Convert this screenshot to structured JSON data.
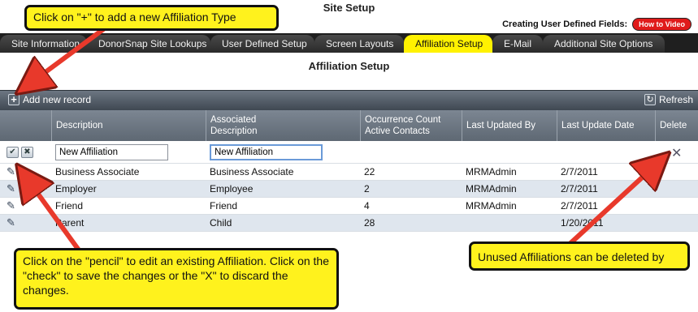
{
  "header": {
    "title": "Site Setup",
    "udf_label": "Creating User Defined Fields:",
    "video_button": "How to Video"
  },
  "tabs": [
    {
      "label": "Site Information"
    },
    {
      "label": "DonorSnap Site Lookups"
    },
    {
      "label": "User Defined Setup"
    },
    {
      "label": "Screen Layouts"
    },
    {
      "label": "Affiliation Setup",
      "active": true
    },
    {
      "label": "E-Mail"
    },
    {
      "label": "Additional Site Options"
    }
  ],
  "section_title": "Affiliation Setup",
  "toolbar": {
    "add_label": "Add new record",
    "refresh_label": "Refresh",
    "add_icon": "plus-icon",
    "refresh_icon": "refresh-icon"
  },
  "columns": {
    "description": "Description",
    "assoc_line1": "Associated",
    "assoc_line2": "Description",
    "count_line1": "Occurrence Count",
    "count_line2": "Active Contacts",
    "last_updated_by": "Last Updated By",
    "last_update_date": "Last Update Date",
    "delete": "Delete"
  },
  "edit_row": {
    "description_value": "New Affiliation",
    "associated_value": "New Affiliation"
  },
  "rows": [
    {
      "description": "Business Associate",
      "associated": "Business Associate",
      "count": "22",
      "updated_by": "MRMAdmin",
      "date": "2/7/2011"
    },
    {
      "description": "Employer",
      "associated": "Employee",
      "count": "2",
      "updated_by": "MRMAdmin",
      "date": "2/7/2011"
    },
    {
      "description": "Friend",
      "associated": "Friend",
      "count": "4",
      "updated_by": "MRMAdmin",
      "date": "2/7/2011"
    },
    {
      "description": "Parent",
      "associated": "Child",
      "count": "28",
      "updated_by": "",
      "date": "1/20/2011"
    }
  ],
  "callouts": {
    "top": "Click on \"+\" to add a new Affiliation Type",
    "bottom_left": "Click on the \"pencil\" to edit an existing Affiliation.  Click on the \"check\" to save the changes or the \"X\" to discard the changes.",
    "bottom_right": "Unused Affiliations can be deleted by"
  },
  "colors": {
    "active_tab": "#fff200",
    "callout": "#fff21d",
    "arrow": "#e8392b",
    "video_button": "#e01b1b"
  }
}
